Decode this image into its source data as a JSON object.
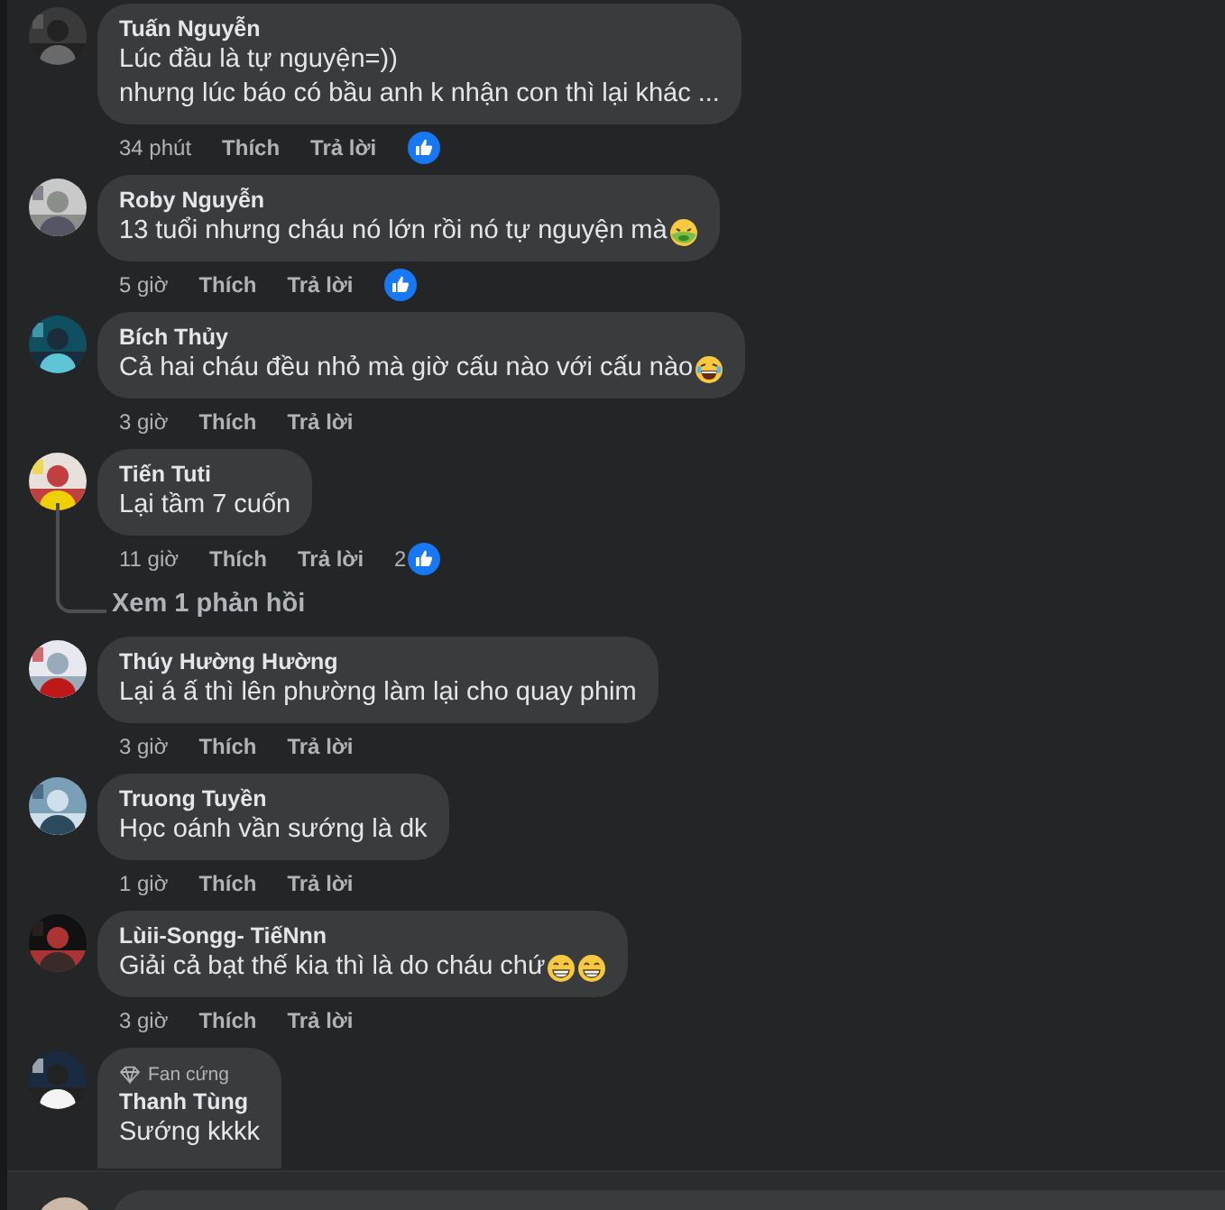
{
  "comments": [
    {
      "name": "Tuấn Nguyễn",
      "lines": [
        "Lúc đầu là tự nguyện=))",
        "nhưng lúc báo có bầu anh k nhận con thì lại khác ..."
      ],
      "time": "34 phút",
      "like": "Thích",
      "reply": "Trả lời",
      "reaction": {
        "kind": "like"
      }
    },
    {
      "name": "Roby Nguyễn",
      "lines": [
        "13 tuổi nhưng cháu nó lớn rồi nó tự nguyện mà"
      ],
      "emojis": [
        {
          "kind": "nauseated"
        }
      ],
      "time": "5 giờ",
      "like": "Thích",
      "reply": "Trả lời",
      "reaction": {
        "kind": "like"
      }
    },
    {
      "name": "Bích Thủy",
      "lines": [
        "Cả hai cháu đều nhỏ mà giờ cấu nào với cấu nào "
      ],
      "emojis": [
        {
          "kind": "laughing"
        }
      ],
      "time": "3 giờ",
      "like": "Thích",
      "reply": "Trả lời"
    },
    {
      "name": "Tiến Tuti",
      "lines": [
        "Lại tầm 7 cuốn"
      ],
      "time": "11 giờ",
      "like": "Thích",
      "reply": "Trả lời",
      "reaction": {
        "kind": "like",
        "count": "2"
      },
      "replies_link": "Xem 1 phản hồi"
    },
    {
      "name": "Thúy Hường Hường",
      "lines": [
        "Lại á ấ thì lên phường làm lại cho quay phim"
      ],
      "time": "3 giờ",
      "like": "Thích",
      "reply": "Trả lời"
    },
    {
      "name": "Truong Tuyền",
      "lines": [
        "Học oánh vần sướng là dk"
      ],
      "time": "1 giờ",
      "like": "Thích",
      "reply": "Trả lời"
    },
    {
      "name": "Lùii-Songg- TiếNnn",
      "lines": [
        "Giải cả bạt thế kia thì là do cháu chứ"
      ],
      "emojis": [
        {
          "kind": "grinning"
        },
        {
          "kind": "grinning"
        }
      ],
      "time": "3 giờ",
      "like": "Thích",
      "reply": "Trả lời"
    },
    {
      "name": "Thanh Tùng",
      "badge": "Fan cứng",
      "lines": [
        "Sướng kkkk"
      ]
    }
  ]
}
